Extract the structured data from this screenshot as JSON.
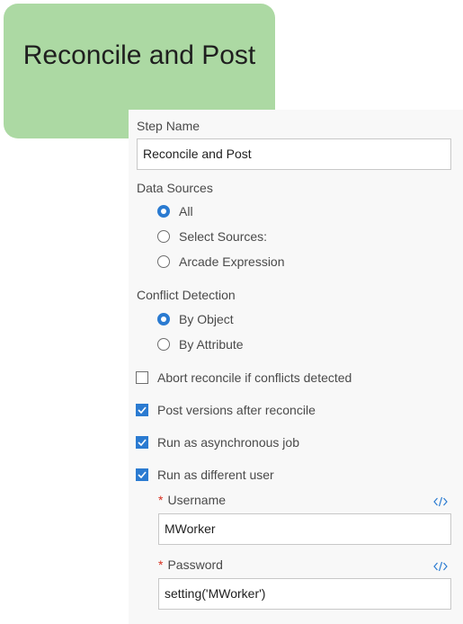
{
  "step_node": {
    "title": "Reconcile and Post",
    "color": "#acd9a3"
  },
  "panel": {
    "step_name": {
      "label": "Step Name",
      "value": "Reconcile and Post"
    },
    "data_sources": {
      "label": "Data Sources",
      "options": [
        {
          "label": "All",
          "selected": true
        },
        {
          "label": "Select Sources:",
          "selected": false
        },
        {
          "label": "Arcade Expression",
          "selected": false
        }
      ]
    },
    "conflict_detection": {
      "label": "Conflict Detection",
      "options": [
        {
          "label": "By Object",
          "selected": true
        },
        {
          "label": "By Attribute",
          "selected": false
        }
      ]
    },
    "checkboxes": [
      {
        "label": "Abort reconcile if conflicts detected",
        "checked": false
      },
      {
        "label": "Post versions after reconcile",
        "checked": true
      },
      {
        "label": "Run as asynchronous job",
        "checked": true
      },
      {
        "label": "Run as different user",
        "checked": true
      }
    ],
    "username": {
      "required_mark": "*",
      "label": "Username",
      "value": "MWorker",
      "icon": "code-expression-icon"
    },
    "password": {
      "required_mark": "*",
      "label": "Password",
      "value": "setting('MWorker')",
      "icon": "code-expression-icon"
    }
  },
  "colors": {
    "accent": "#2b7bd1",
    "required": "#d83020",
    "panel_bg": "#f8f8f8"
  }
}
